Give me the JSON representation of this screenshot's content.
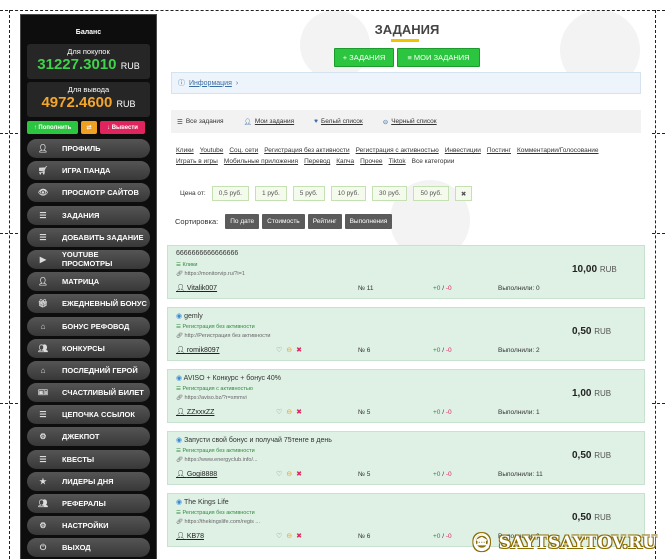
{
  "sidebar": {
    "title": "Баланс",
    "buy_label": "Для покупок",
    "buy_value": "31227.3010",
    "buy_currency": "RUB",
    "withdraw_label": "Для вывода",
    "withdraw_value": "4972.4600",
    "withdraw_currency": "RUB",
    "topup_label": "Пополнить",
    "withdraw_btn_label": "Вывести",
    "menu": [
      {
        "label": "Профиль",
        "icon": "user-icon"
      },
      {
        "label": "Игра Панда",
        "icon": "cart-icon"
      },
      {
        "label": "Просмотр сайтов",
        "icon": "eye-icon"
      },
      {
        "label": "Задания",
        "icon": "list-icon"
      },
      {
        "label": "Добавить задание",
        "icon": "list-icon"
      },
      {
        "label": "YouTube просмотры",
        "icon": "youtube-icon"
      },
      {
        "label": "Матрица",
        "icon": "plus-user-icon"
      },
      {
        "label": "Ежедневный бонус",
        "icon": "gift-icon"
      },
      {
        "label": "Бонус рефовод",
        "icon": "home-icon"
      },
      {
        "label": "Конкурсы",
        "icon": "group-icon"
      },
      {
        "label": "Последний герой",
        "icon": "home-icon"
      },
      {
        "label": "Счастливый билет",
        "icon": "ticket-icon"
      },
      {
        "label": "Цепочка ссылок",
        "icon": "list-icon"
      },
      {
        "label": "Джекпот",
        "icon": "gears-icon"
      },
      {
        "label": "Квесты",
        "icon": "list-icon"
      },
      {
        "label": "Лидеры дня",
        "icon": "star-icon"
      },
      {
        "label": "Рефералы",
        "icon": "group-icon"
      },
      {
        "label": "Настройки",
        "icon": "gear-icon"
      },
      {
        "label": "Выход",
        "icon": "exit-icon"
      }
    ]
  },
  "page": {
    "title": "ЗАДАНИЯ",
    "btn_tasks": "+ ЗАДАНИЯ",
    "btn_my_tasks": "≡ МОИ ЗАДАНИЯ",
    "info": "Информация",
    "filter_all": "Все задания",
    "filter_mine": "Мои задания",
    "filter_white": "Белый список",
    "filter_black": "Черный список",
    "categories": [
      "Клики",
      "Youtube",
      "Соц. сети",
      "Регистрация без активности",
      "Регистрация с активностью",
      "Инвестиции",
      "Постинг",
      "Комментарии/Голосование",
      "Играть в игры",
      "Мобильные приложения",
      "Перевод",
      "Капча",
      "Прочее",
      "Tiktok",
      "Все категории"
    ],
    "price_label": "Цена от:",
    "prices": [
      "0,5 руб.",
      "1 руб.",
      "5 руб.",
      "10 руб.",
      "30 руб.",
      "50 руб.",
      "✖"
    ],
    "sort_label": "Сортировка:",
    "sort_options": [
      "По дате",
      "Стоимость",
      "Рейтинг",
      "Выполнения"
    ]
  },
  "tasks": [
    {
      "title": "6666666666666666",
      "category": "Клики",
      "url": "https://monitorvip.ru/?i=1",
      "user": "Vitalik007",
      "num": "№ 11",
      "votes_up": "+0",
      "votes_down": "-0",
      "done": "Выполнили: 0",
      "amount": "10,00",
      "currency": "RUB"
    },
    {
      "title": "gemly",
      "category": "Регистрация без активности",
      "url": "http://Регистрация без активности",
      "user": "romik8097",
      "num": "№ 6",
      "votes_up": "+0",
      "votes_down": "-0",
      "done": "Выполнили: 2",
      "amount": "0,50",
      "currency": "RUB"
    },
    {
      "title": "AVISO + Конкурс + бонус 40%",
      "category": "Регистрация с активностью",
      "url": "https://aviso.bz/?r=smmvi",
      "user": "ZZxxxZZ",
      "num": "№ 5",
      "votes_up": "+0",
      "votes_down": "-0",
      "done": "Выполнили: 1",
      "amount": "1,00",
      "currency": "RUB"
    },
    {
      "title": "Запусти свой бонус и получай 75тенге в день",
      "category": "Регистрация без активности",
      "url": "https://www.energyclub.info/...",
      "user": "Gogi8888",
      "num": "№ 5",
      "votes_up": "+0",
      "votes_down": "-0",
      "done": "Выполнили: 11",
      "amount": "0,50",
      "currency": "RUB"
    },
    {
      "title": "The Kings Life",
      "category": "Регистрация без активности",
      "url": "https://thekingslife.com/regis ...",
      "user": "KB78",
      "num": "№ 6",
      "votes_up": "+0",
      "votes_down": "-0",
      "done": "Выполнили: 0",
      "amount": "0,50",
      "currency": "RUB"
    }
  ],
  "watermark": "SAYTSAYTOV.RU"
}
